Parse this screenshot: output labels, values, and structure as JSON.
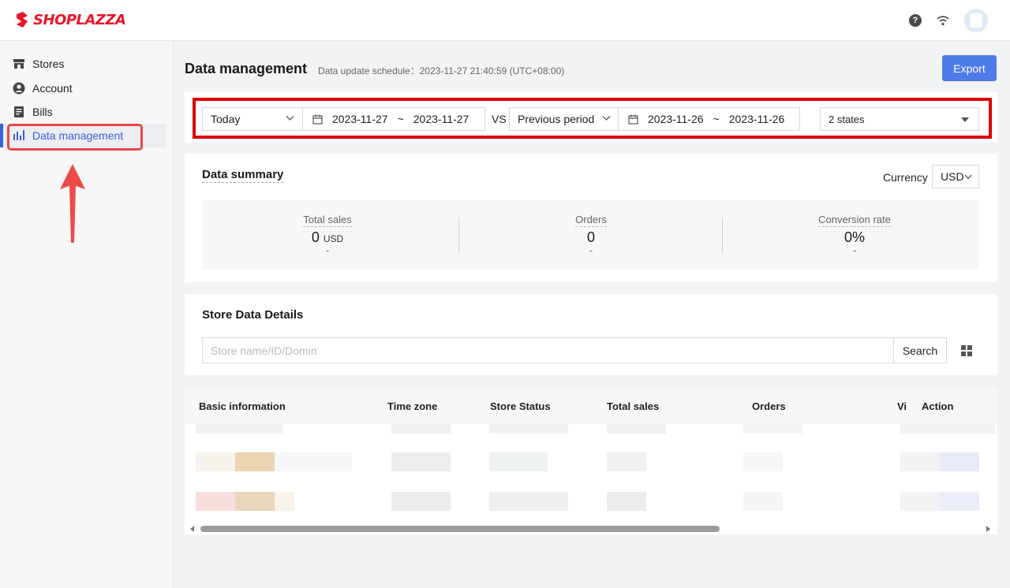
{
  "brand": {
    "name": "SHOPLAZZA",
    "color": "#e8162a"
  },
  "header": {
    "icons": [
      "help-icon",
      "wifi-icon",
      "avatar"
    ]
  },
  "sidebar": {
    "items": [
      {
        "label": "Stores",
        "icon": "store-icon"
      },
      {
        "label": "Account",
        "icon": "user-icon"
      },
      {
        "label": "Bills",
        "icon": "bill-icon"
      },
      {
        "label": "Data management",
        "icon": "bar-chart-icon",
        "active": true
      }
    ]
  },
  "page": {
    "title": "Data management",
    "update_schedule": "Data update schedule：2023-11-27 21:40:59 (UTC+08:00)",
    "export_label": "Export"
  },
  "filters": {
    "period": "Today",
    "range_start": "2023-11-27",
    "range_sep": "~",
    "range_end": "2023-11-27",
    "vs": "VS",
    "compare": "Previous period",
    "compare_start": "2023-11-26",
    "compare_sep": "~",
    "compare_end": "2023-11-26",
    "states": "2 states"
  },
  "summary": {
    "title": "Data summary",
    "currency_label": "Currency",
    "currency": "USD",
    "metrics": [
      {
        "label": "Total sales",
        "value": "0",
        "unit": "USD",
        "sub": "-"
      },
      {
        "label": "Orders",
        "value": "0",
        "unit": "",
        "sub": "-"
      },
      {
        "label": "Conversion rate",
        "value": "0%",
        "unit": "",
        "sub": "-"
      }
    ]
  },
  "details": {
    "title": "Store Data Details",
    "search_placeholder": "Store name/ID/Domin",
    "search_label": "Search",
    "columns": [
      "Basic information",
      "Time zone",
      "Store Status",
      "Total sales",
      "Orders",
      "Vi",
      "Action"
    ]
  },
  "accent": "#4d7ce8",
  "highlight": "#d90000"
}
